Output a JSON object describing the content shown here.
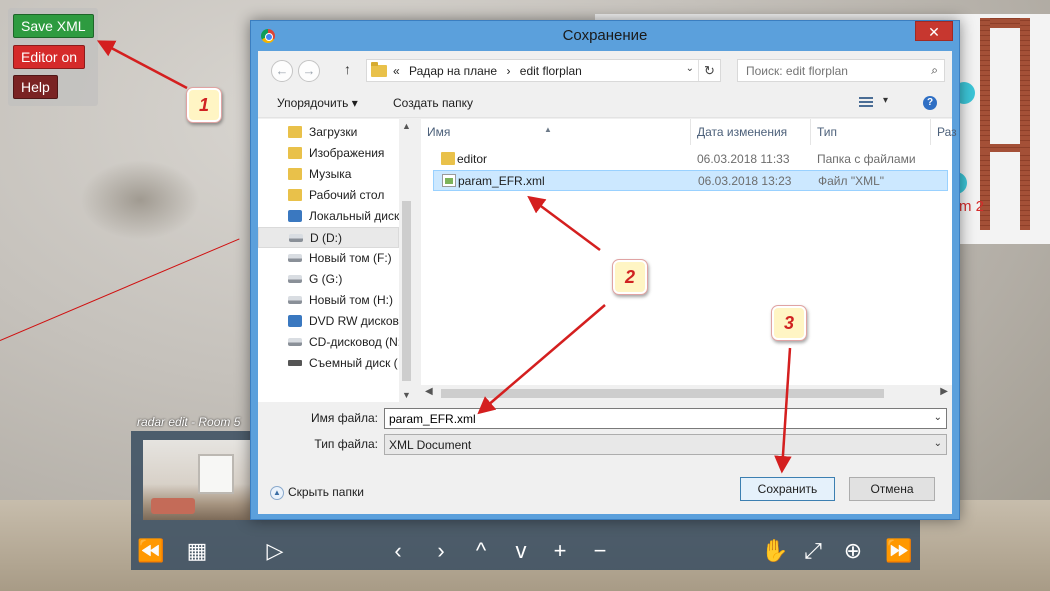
{
  "toolbar": {
    "save_label": "Save XML",
    "editor_label": "Editor on",
    "help_label": "Help"
  },
  "plan": {
    "room_label": "m 2"
  },
  "viewer": {
    "thumb_label": "radar edit - Room 5",
    "nav_icons": [
      "skip-back-icon",
      "grid-icon",
      "play-icon",
      "chevron-left-icon",
      "chevron-right-icon",
      "chevron-up-icon",
      "chevron-down-icon",
      "zoom-in-icon",
      "zoom-out-icon",
      "hand-icon",
      "fullscreen-icon",
      "download-icon",
      "skip-forward-icon"
    ],
    "glyphs": {
      "skip_back": "⏪",
      "grid": "▦",
      "play": "▷",
      "left": "‹",
      "right": "›",
      "up": "^",
      "down": "v",
      "plus": "+",
      "minus": "−",
      "hand": "✋",
      "fullscreen": "⤢",
      "down_circle": "⊕",
      "skip_fwd": "⏩"
    }
  },
  "dialog": {
    "title": "Сохранение",
    "close_glyph": "✕",
    "back_glyph": "←",
    "forward_glyph": "→",
    "up_glyph": "↑",
    "breadcrumb_sep": "«",
    "breadcrumb": [
      "Радар на плане",
      "edit florplan"
    ],
    "crumb_arrow": "›",
    "dropdown_glyph": "⌄",
    "refresh_glyph": "↻",
    "search_placeholder": "Поиск: edit florplan",
    "search_glyph": "⌕",
    "organize_label": "Упорядочить ▾",
    "new_folder_label": "Создать папку",
    "views_dropdown": "▾",
    "help_glyph": "?",
    "nav_items": [
      {
        "label": "Загрузки",
        "icon": "folder-download-icon",
        "kind": "folder"
      },
      {
        "label": "Изображения",
        "icon": "folder-pictures-icon",
        "kind": "folder"
      },
      {
        "label": "Музыка",
        "icon": "folder-music-icon",
        "kind": "folder"
      },
      {
        "label": "Рабочий стол",
        "icon": "folder-desktop-icon",
        "kind": "folder"
      },
      {
        "label": "Локальный диск",
        "icon": "local-disk-icon",
        "kind": "disc"
      },
      {
        "label": "D (D:)",
        "icon": "drive-icon",
        "kind": "drive"
      },
      {
        "label": "Новый том (F:)",
        "icon": "drive-icon",
        "kind": "drive"
      },
      {
        "label": "G (G:)",
        "icon": "drive-icon",
        "kind": "drive"
      },
      {
        "label": "Новый том (H:)",
        "icon": "drive-icon",
        "kind": "drive"
      },
      {
        "label": "DVD RW дисково",
        "icon": "dvd-drive-icon",
        "kind": "disc"
      },
      {
        "label": "CD-дисковод (N:",
        "icon": "cd-drive-icon",
        "kind": "drive"
      },
      {
        "label": "Съемный диск (",
        "icon": "removable-disk-icon",
        "kind": "usb"
      }
    ],
    "selected_nav_index": 5,
    "columns": [
      "Имя",
      "Дата изменения",
      "Тип",
      "Раз"
    ],
    "files": [
      {
        "name": "editor",
        "date": "06.03.2018 11:33",
        "type": "Папка с файлами",
        "icon": "folder-icon"
      },
      {
        "name": "param_EFR.xml",
        "date": "06.03.2018 13:23",
        "type": "Файл \"XML\"",
        "icon": "xml-file-icon"
      }
    ],
    "filename_label": "Имя файла:",
    "filename_value": "param_EFR.xml",
    "filetype_label": "Тип файла:",
    "filetype_value": "XML Document",
    "hide_folders_label": "Скрыть папки",
    "save_button": "Сохранить",
    "cancel_button": "Отмена"
  },
  "callouts": [
    "1",
    "2",
    "3"
  ],
  "colors": {
    "save_green": "#2e9b40",
    "editor_red": "#d52a2a",
    "help_maroon": "#7a2323",
    "dialog_frame": "#5ba0dc",
    "selection": "#cce8ff",
    "arrow_red": "#d41f1f"
  }
}
